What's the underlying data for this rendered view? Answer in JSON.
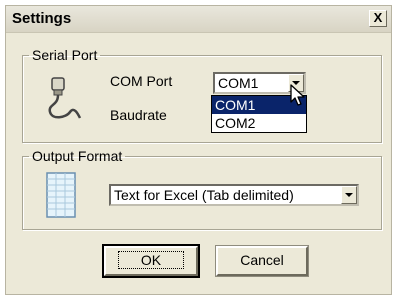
{
  "dialog": {
    "title": "Settings",
    "close_label": "X"
  },
  "serial_port": {
    "legend": "Serial Port",
    "com_port_label": "COM Port",
    "baudrate_label": "Baudrate",
    "com_port_value": "COM1",
    "com_port_options": [
      "COM1",
      "COM2"
    ],
    "selected_option_index": 0
  },
  "output_format": {
    "legend": "Output Format",
    "value": "Text for Excel (Tab delimited)"
  },
  "buttons": {
    "ok_label": "OK",
    "cancel_label": "Cancel"
  },
  "colors": {
    "highlight": "#0a246a",
    "dialog_bg": "#ece9d8"
  },
  "icons": {
    "serial": "serial-cable-icon",
    "output": "spreadsheet-icon",
    "cursor": "mouse-pointer-icon"
  }
}
